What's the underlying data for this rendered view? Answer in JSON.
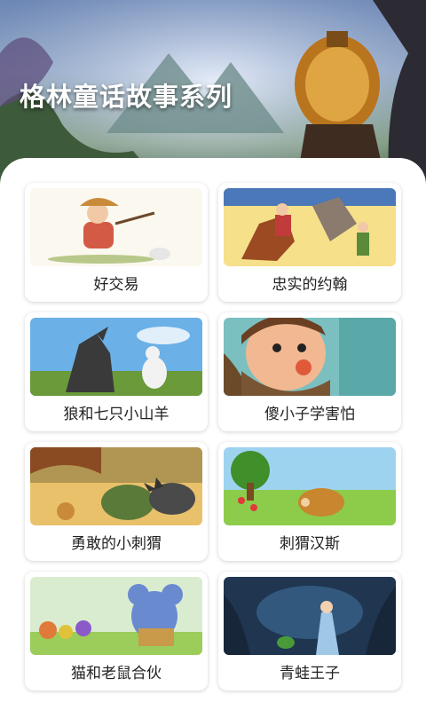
{
  "header": {
    "title": "格林童话故事系列"
  },
  "stories": [
    {
      "title": "好交易",
      "icon": "farmer-illustration"
    },
    {
      "title": "忠实的约翰",
      "icon": "knight-horse-illustration"
    },
    {
      "title": "狼和七只小山羊",
      "icon": "wolf-goat-illustration"
    },
    {
      "title": "傻小子学害怕",
      "icon": "boy-face-illustration"
    },
    {
      "title": "勇敢的小刺猬",
      "icon": "hedgehog-forest-illustration"
    },
    {
      "title": "刺猬汉斯",
      "icon": "hedgehog-meadow-illustration"
    },
    {
      "title": "猫和老鼠合伙",
      "icon": "mouse-illustration"
    },
    {
      "title": "青蛙王子",
      "icon": "frog-prince-illustration"
    }
  ]
}
